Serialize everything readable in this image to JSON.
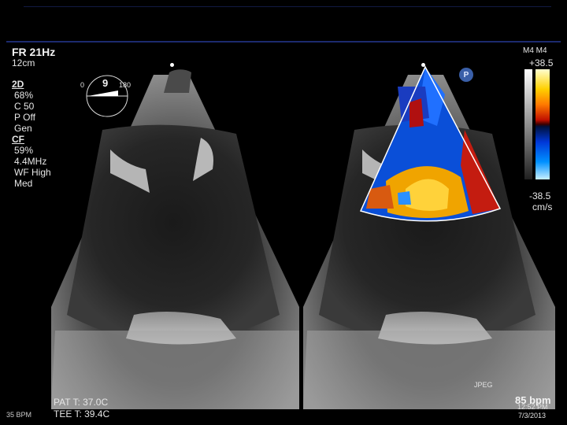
{
  "left_panel": {
    "frame_rate": "FR 21Hz",
    "depth": "12cm",
    "mode_2d": "2D",
    "gain_2d": "68%",
    "compress": "C 50",
    "persistence": "P Off",
    "freq_mode": "Gen",
    "mode_cf": "CF",
    "gain_cf": "59%",
    "cf_freq": "4.4MHz",
    "wall_filter": "WF High",
    "cf_setting": "Med"
  },
  "angle_indicator": {
    "angle": "9",
    "min": "0",
    "max": "180"
  },
  "right_panel": {
    "probe": "M4 M4",
    "velocity_max": "+38.5",
    "velocity_min": "-38.5",
    "velocity_unit": "cm/s",
    "p_badge": "P"
  },
  "bottom": {
    "left_bpm": "35 BPM",
    "pat_temp": "PAT T: 37.0C",
    "tee_temp": "TEE T: 39.4C",
    "jpeg": "JPEG",
    "heart_rate": "85 bpm",
    "time": "12:52 PM",
    "date": "7/3/2013"
  },
  "colors": {
    "background": "#000000",
    "top_rule": "#1c2a6e",
    "doppler_red": "#c01000",
    "doppler_blue": "#0038d8",
    "doppler_yellow": "#ffd000"
  }
}
